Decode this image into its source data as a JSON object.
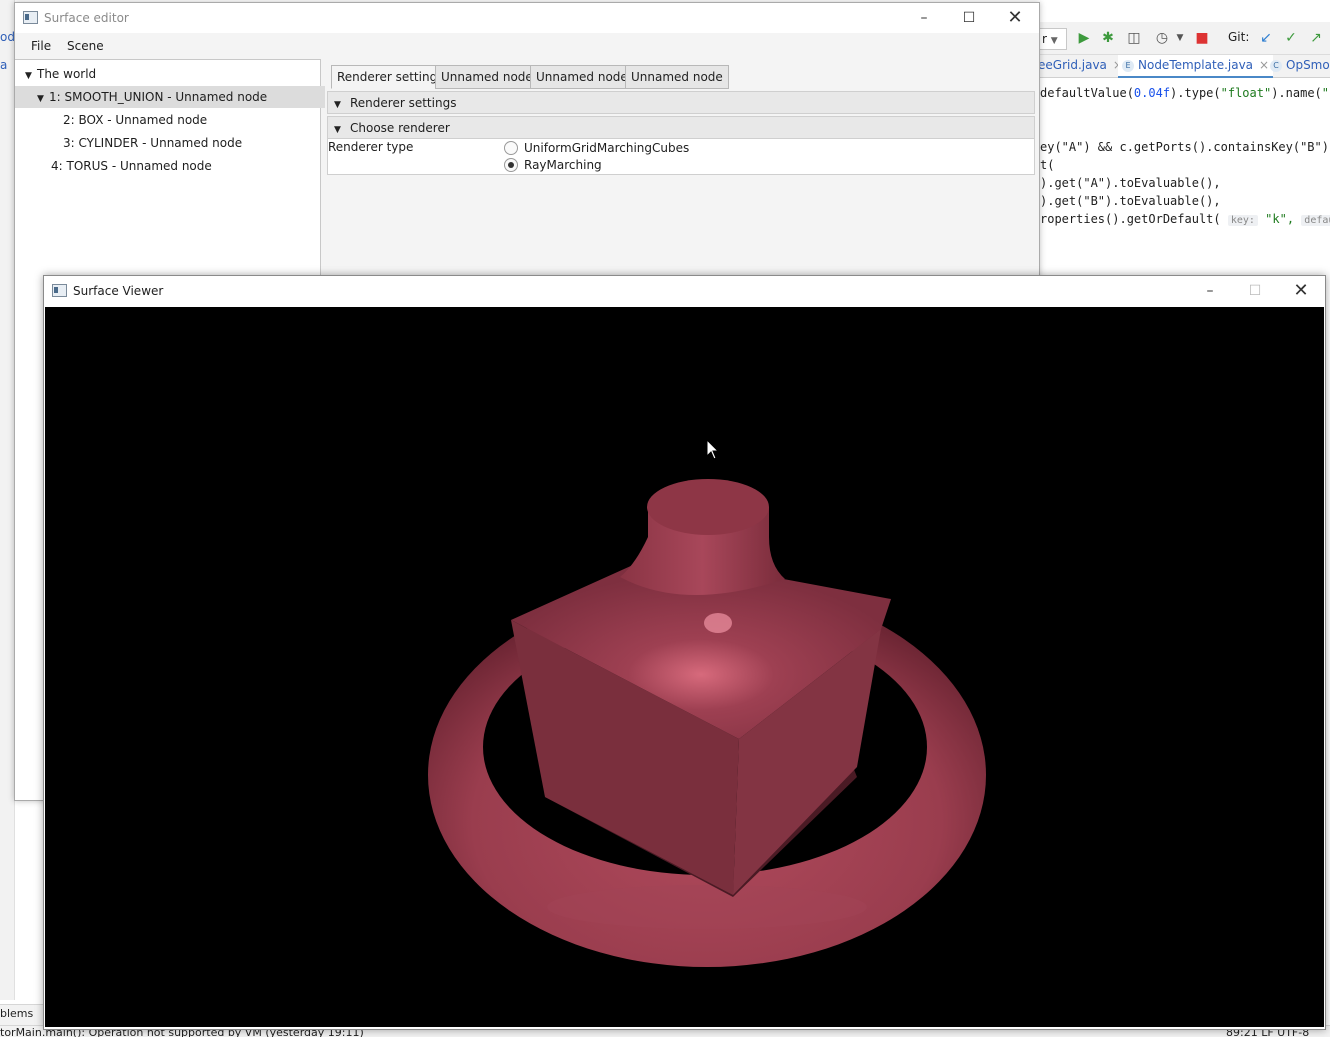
{
  "ide": {
    "left_fragments": [
      "ode",
      "a"
    ],
    "toolbar": {
      "git_label": "Git:",
      "dropdown_fragment": "r"
    },
    "tabs": [
      {
        "label": "eeGrid.java",
        "badge": ""
      },
      {
        "label": "NodeTemplate.java",
        "badge": "E"
      },
      {
        "label": "OpSmo",
        "badge": "C"
      }
    ],
    "code_lines": [
      {
        "pre": "defaultValue(",
        "num": "0.04f",
        "mid": ").type(",
        "s1": "\"float\"",
        "post": ").name(",
        "s2": "\"k\""
      },
      {
        "text": "ey(\"A\") && c.getPorts().containsKey(\"B\") ?"
      },
      {
        "text": "t("
      },
      {
        "text": ").get(\"A\").toEvaluable(),"
      },
      {
        "text": ").get(\"B\").toEvaluable(),"
      },
      {
        "pre": "roperties().getOrDefault( ",
        "hint1": "key:",
        "s1": " \"k\", ",
        "hint2": "defaultV"
      }
    ],
    "problems_label": "blems",
    "status_text": "torMain.main(): Operation not supported by VM (yesterday 19:11)",
    "status_right": "89:21   LF   UTF-8"
  },
  "editor": {
    "title": "Surface editor",
    "menu": [
      "File",
      "Scene"
    ],
    "tree": [
      {
        "label": "The world",
        "level": 0,
        "expanded": true,
        "selected": false
      },
      {
        "label": "1: SMOOTH_UNION - Unnamed node",
        "level": 1,
        "expanded": true,
        "selected": true
      },
      {
        "label": "2: BOX - Unnamed node",
        "level": 2,
        "expanded": false,
        "selected": false
      },
      {
        "label": "3: CYLINDER - Unnamed node",
        "level": 2,
        "expanded": false,
        "selected": false
      },
      {
        "label": "4: TORUS - Unnamed node",
        "level": 1,
        "expanded": false,
        "selected": false
      }
    ],
    "tabs": [
      "Renderer settings",
      "Unnamed node",
      "Unnamed node",
      "Unnamed node"
    ],
    "active_tab": 0,
    "sections": {
      "renderer_settings": "Renderer settings",
      "choose_renderer": "Choose renderer"
    },
    "renderer_type_label": "Renderer type",
    "renderer_options": [
      {
        "label": "UniformGridMarchingCubes",
        "selected": false
      },
      {
        "label": "RayMarching",
        "selected": true
      }
    ]
  },
  "viewer": {
    "title": "Surface Viewer",
    "background": "#000000",
    "surface_color": "#9a3d4e"
  }
}
